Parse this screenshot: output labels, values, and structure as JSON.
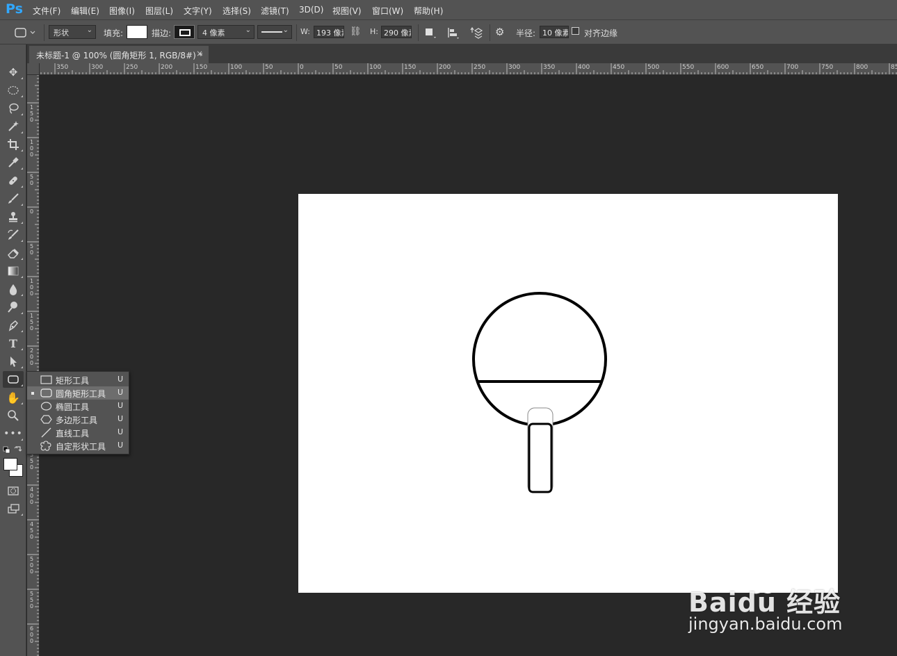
{
  "app": {
    "logo": "Ps",
    "menu": [
      "文件(F)",
      "编辑(E)",
      "图像(I)",
      "图层(L)",
      "文字(Y)",
      "选择(S)",
      "滤镜(T)",
      "3D(D)",
      "视图(V)",
      "窗口(W)",
      "帮助(H)"
    ]
  },
  "options": {
    "mode": "形状",
    "fill_label": "填充:",
    "stroke_label": "描边:",
    "stroke_width": "4 像素",
    "w_label": "W:",
    "w_value": "193 像素",
    "h_label": "H:",
    "h_value": "290 像素",
    "radius_label": "半径:",
    "radius_value": "10 像素",
    "align_edges_label": "对齐边缘",
    "fill_color": "#ffffff",
    "stroke_color": "#000000"
  },
  "document": {
    "tab_title": "未标题-1 @ 100% (圆角矩形 1, RGB/8#) *",
    "close": "×",
    "canvas_color": "#ffffff"
  },
  "ruler": {
    "h_labels": [
      "350",
      "300",
      "250",
      "200",
      "150",
      "100",
      "50",
      "0",
      "50",
      "100",
      "150",
      "200",
      "250",
      "300",
      "350",
      "400",
      "450",
      "500",
      "550",
      "600",
      "650",
      "700",
      "750",
      "800",
      "85"
    ],
    "v_labels": [
      "150",
      "100",
      "50",
      "0",
      "50",
      "100",
      "150",
      "200",
      "250",
      "300",
      "350",
      "400",
      "450",
      "500",
      "550",
      "600",
      "6"
    ]
  },
  "flyout": {
    "items": [
      {
        "icon": "rectangle-icon",
        "label": "矩形工具",
        "key": "U",
        "selected": false
      },
      {
        "icon": "rounded-rectangle-icon",
        "label": "圆角矩形工具",
        "key": "U",
        "selected": true
      },
      {
        "icon": "ellipse-icon",
        "label": "椭圆工具",
        "key": "U",
        "selected": false
      },
      {
        "icon": "polygon-icon",
        "label": "多边形工具",
        "key": "U",
        "selected": false
      },
      {
        "icon": "line-icon",
        "label": "直线工具",
        "key": "U",
        "selected": false
      },
      {
        "icon": "custom-shape-icon",
        "label": "自定形状工具",
        "key": "U",
        "selected": false
      }
    ]
  },
  "watermark": {
    "brand": "Baidu 经验",
    "url": "jingyan.baidu.com"
  }
}
